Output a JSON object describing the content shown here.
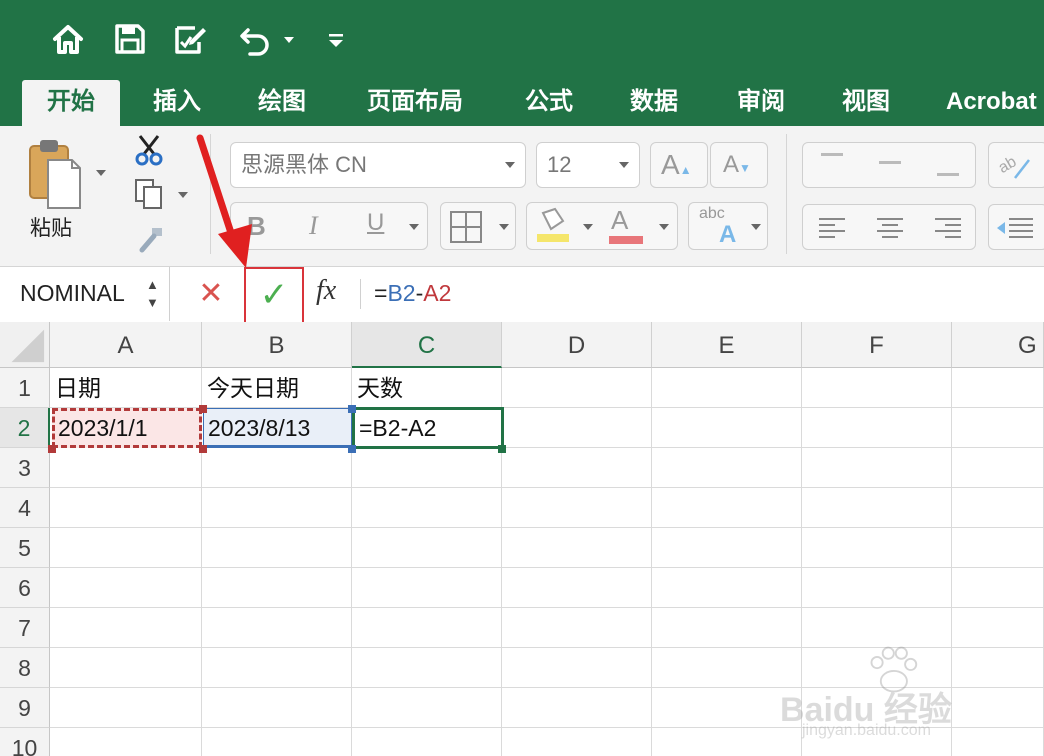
{
  "quick_access": [
    {
      "name": "home-icon"
    },
    {
      "name": "save-icon"
    },
    {
      "name": "edit-document-icon"
    },
    {
      "name": "undo-icon"
    },
    {
      "name": "undo-dropdown-icon"
    },
    {
      "name": "customize-toolbar-icon"
    }
  ],
  "tabs": [
    {
      "label": "开始",
      "active": true
    },
    {
      "label": "插入"
    },
    {
      "label": "绘图"
    },
    {
      "label": "页面布局"
    },
    {
      "label": "公式"
    },
    {
      "label": "数据"
    },
    {
      "label": "审阅"
    },
    {
      "label": "视图"
    },
    {
      "label": "Acrobat"
    }
  ],
  "ribbon": {
    "paste_label": "粘贴",
    "font_name": "思源黑体 CN",
    "font_size": "12",
    "bold": "B",
    "italic": "I",
    "underline": "U",
    "grow_font": "A",
    "shrink_font": "A",
    "font_color_letter": "A",
    "abc_label": "abc",
    "abc_letter": "A",
    "colors": {
      "fill": "#f5e66b",
      "font": "#e8767a",
      "highlight": "#7ab8e8"
    }
  },
  "formula_bar": {
    "name_box": "NOMINAL",
    "cancel_symbol": "✕",
    "confirm_symbol": "✓",
    "fx": "fx",
    "formula_parts": {
      "eq": "=",
      "ref1": "B2",
      "op": "-",
      "ref2": "A2"
    },
    "colors": {
      "ref1": "#3b6fb6",
      "ref2": "#c0383c",
      "confirm": "#4caf50",
      "cancel": "#d9534f",
      "highlight_box": "#d9343a",
      "arrow": "#e02020"
    }
  },
  "columns": [
    "A",
    "B",
    "C",
    "D",
    "E",
    "F",
    "G"
  ],
  "rows": [
    "1",
    "2",
    "3",
    "4",
    "5",
    "6",
    "7",
    "8",
    "9",
    "10"
  ],
  "cells": {
    "A1": "日期",
    "B1": "今天日期",
    "C1": "天数",
    "A2": "2023/1/1",
    "B2": "2023/8/13",
    "C2": "=B2-A2"
  },
  "selection": {
    "active_cell": "C2",
    "ref_cells": [
      "A2",
      "B2"
    ]
  },
  "watermark": {
    "text": "Baidu 经验",
    "url": "jingyan.baidu.com"
  }
}
